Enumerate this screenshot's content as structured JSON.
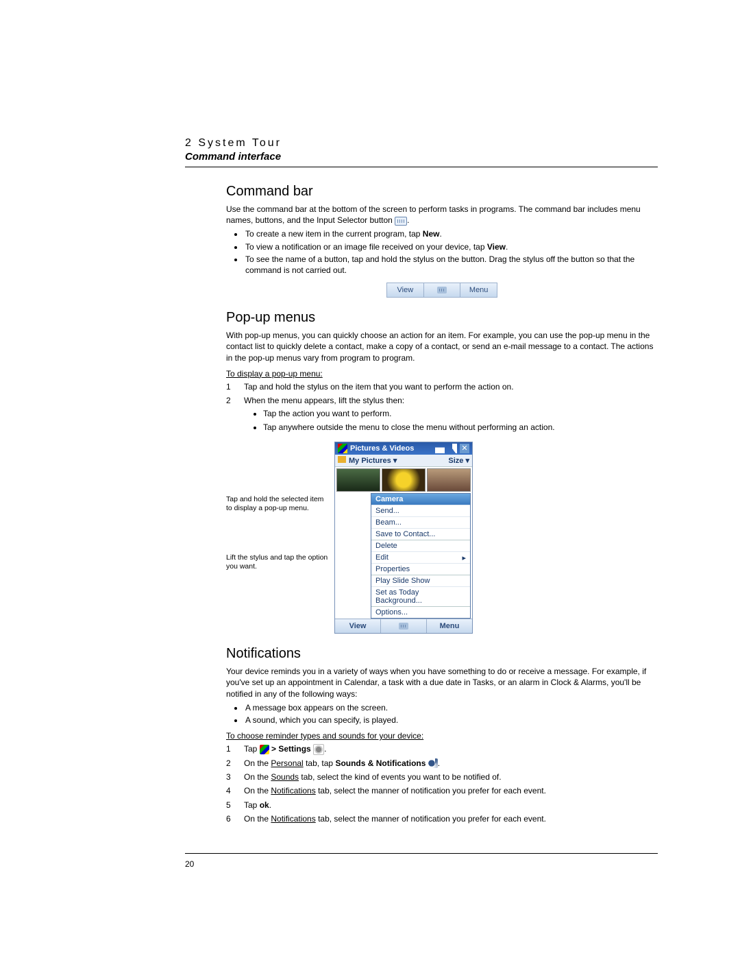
{
  "header": {
    "chapter": "2 System Tour",
    "section": "Command interface"
  },
  "command_bar": {
    "heading": "Command bar",
    "para": "Use the command bar at the bottom of the screen to perform tasks in programs. The command bar includes menu names, buttons, and the Input Selector button ",
    "bullets": [
      {
        "pre": "To create a new item in the current program, tap ",
        "bold": "New",
        "post": "."
      },
      {
        "pre": "To view a notification or an image file received on your device, tap ",
        "bold": "View",
        "post": "."
      },
      {
        "pre": "To see the name of a button, tap and hold the stylus on the button. Drag the stylus off the button so that the command is not carried out.",
        "bold": "",
        "post": ""
      }
    ],
    "figure": {
      "left": "View",
      "right": "Menu"
    }
  },
  "popup": {
    "heading": "Pop-up menus",
    "para": "With pop-up menus, you can quickly choose an action for an item. For example, you can use the pop-up menu in the contact list to quickly delete a contact, make a copy of a contact, or send an e-mail message to a contact. The actions in the pop-up menus vary from program to program.",
    "instr_title": "To display a pop-up menu:",
    "steps": [
      "Tap and hold the stylus on the item that you want to perform the action on.",
      "When the menu appears, lift the stylus then:"
    ],
    "substeps": [
      "Tap the action you want to perform.",
      "Tap anywhere outside the menu to close the menu without performing an action."
    ],
    "callouts": [
      "Tap and hold the selected item to display a pop-up menu.",
      "Lift the stylus and tap the option you want."
    ],
    "device": {
      "title": "Pictures & Videos",
      "sub_left": "My Pictures",
      "sub_right": "Size",
      "menu_header": "Camera",
      "menu_items": [
        "Send...",
        "Beam...",
        "Save to Contact...",
        "Delete",
        "Edit",
        "Properties",
        "Play Slide Show",
        "Set as Today Background...",
        "Options..."
      ],
      "cmd_left": "View",
      "cmd_right": "Menu"
    }
  },
  "notifications": {
    "heading": "Notifications",
    "para": "Your device reminds you in a variety of ways when you have something to do or receive a message. For example, if you've set up an appointment in Calendar, a task with a due date in Tasks, or an alarm in Clock & Alarms, you'll be notified in any of the following ways:",
    "bullets": [
      "A message box appears on the screen.",
      "A sound, which you can specify, is played."
    ],
    "instr_title": "To choose reminder types and sounds for your device:",
    "step1_pre": "Tap ",
    "step1_mid": " > ",
    "step1_bold": "Settings",
    "step2_pre": "On the ",
    "step2_u": "Personal",
    "step2_mid": " tab, tap ",
    "step2_bold": "Sounds & Notifications",
    "step3_pre": "On the ",
    "step3_u": "Sounds",
    "step3_post": " tab, select the kind of events you want to be notified of.",
    "step4_pre": "On the ",
    "step4_u": "Notifications",
    "step4_post": " tab, select the manner of notification you prefer for each event.",
    "step5_pre": "Tap ",
    "step5_bold": "ok",
    "step6_pre": "On the ",
    "step6_u": "Notifications",
    "step6_post": " tab, select the manner of notification you prefer for each event."
  },
  "page_number": "20"
}
